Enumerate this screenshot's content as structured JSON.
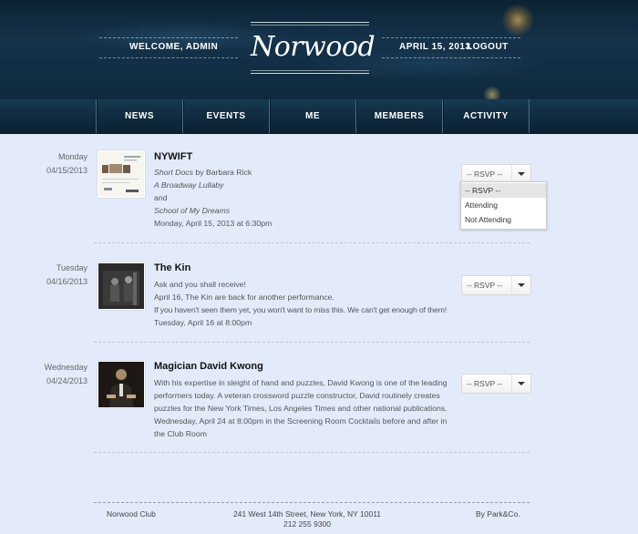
{
  "header": {
    "welcome": "WELCOME, ADMIN",
    "logo": "Norwood",
    "date": "APRIL 15, 2013",
    "logout": "LOGOUT"
  },
  "nav": {
    "items": [
      "NEWS",
      "EVENTS",
      "ME",
      "MEMBERS",
      "ACTIVITY"
    ]
  },
  "events": [
    {
      "day": "Monday",
      "date": "04/15/2013",
      "title": "NYWIFT",
      "body": {
        "line1_italic": "Short Docs",
        "line1_rest": " by Barbara Rick",
        "line2": "A Broadway Lullaby",
        "line3": "and",
        "line4": "School of My Dreams",
        "line5": "Monday, April 15, 2013 at 6:30pm"
      },
      "rsvp": "-- RSVP --"
    },
    {
      "day": "Tuesday",
      "date": "04/16/2013",
      "title": "The Kin",
      "body": {
        "line1": "Ask and you shall receive!",
        "line2": "April 16, The Kin are back for another performance.",
        "line3": "If you haven't seen them yet, you won't want to miss this. We can't get enough of them!",
        "line4": "Tuesday, April 16 at 8:00pm"
      },
      "rsvp": "-- RSVP --"
    },
    {
      "day": "Wednesday",
      "date": "04/24/2013",
      "title": "Magician David Kwong",
      "body": "With his expertise in sleight of hand and puzzles, David Kwong is one of the leading performers today. A veteran crossword puzzle constructor, David routinely creates puzzles for the New York Times, Los Angeles Times and other national publications. Wednesday, April 24 at 8:00pm in the Screening Room Cocktails before and after in the Club Room",
      "rsvp": "-- RSVP --"
    }
  ],
  "rsvp_dropdown": {
    "options": [
      "-- RSVP --",
      "Attending",
      "Not Attending"
    ]
  },
  "footer": {
    "left": "Norwood Club",
    "address": "241 West 14th Street, New York, NY 10011",
    "phone": "212 255 9300",
    "by": "By ",
    "by_brand": "Park&Co."
  }
}
